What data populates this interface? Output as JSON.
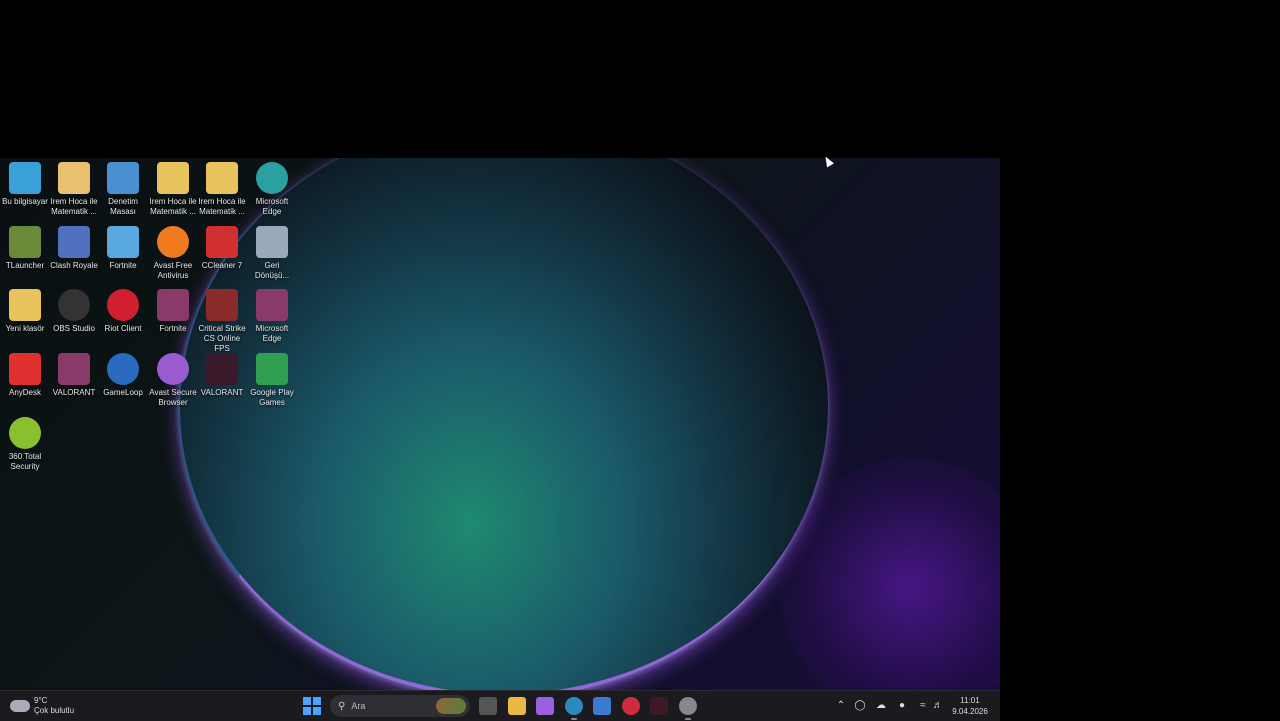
{
  "desktop": {
    "icons": [
      {
        "label": "Bu bilgisayar",
        "icon": "monitor-icon",
        "color": "#3aa0d8"
      },
      {
        "label": "Irem Hoca ile Matematik ...",
        "icon": "anime-avatar-icon",
        "color": "#e8c070"
      },
      {
        "label": "Denetim Masası",
        "icon": "control-panel-icon",
        "color": "#4a8fd0"
      },
      {
        "label": "Irem Hoca ile Matematik ...",
        "icon": "folder-icon",
        "color": "#e8c25a"
      },
      {
        "label": "Irem Hoca ile Matematik ...",
        "icon": "folder-icon",
        "color": "#e8c25a"
      },
      {
        "label": "Microsoft Edge",
        "icon": "edge-icon",
        "color": "#2aa0a0"
      },
      {
        "label": "TLauncher",
        "icon": "minecraft-block-icon",
        "color": "#6a8a3a"
      },
      {
        "label": "Clash Royale",
        "icon": "clash-royale-icon",
        "color": "#5070c0"
      },
      {
        "label": "Fortnite",
        "icon": "fortnite-icon",
        "color": "#5aa8e0"
      },
      {
        "label": "Avast Free Antivirus",
        "icon": "avast-icon",
        "color": "#f07a20"
      },
      {
        "label": "CCleaner 7",
        "icon": "ccleaner-icon",
        "color": "#d03030"
      },
      {
        "label": "Geri Dönüşü...",
        "icon": "recycle-bin-icon",
        "color": "#9ab"
      },
      {
        "label": "Yeni klasör",
        "icon": "folder-icon",
        "color": "#e8c25a"
      },
      {
        "label": "OBS Studio",
        "icon": "obs-icon",
        "color": "#333"
      },
      {
        "label": "Riot Client",
        "icon": "riot-icon",
        "color": "#d02030"
      },
      {
        "label": "Fortnite",
        "icon": "winrar-icon",
        "color": "#8a3a6a"
      },
      {
        "label": "Critical Strike CS Online FPS",
        "icon": "critical-strike-icon",
        "color": "#8a2a2a"
      },
      {
        "label": "Microsoft Edge",
        "icon": "winrar-icon",
        "color": "#8a3a6a"
      },
      {
        "label": "AnyDesk",
        "icon": "anydesk-icon",
        "color": "#e03030"
      },
      {
        "label": "VALORANT",
        "icon": "winrar-icon",
        "color": "#8a3a6a"
      },
      {
        "label": "GameLoop",
        "icon": "gameloop-icon",
        "color": "#2a6ac0"
      },
      {
        "label": "Avast Secure Browser",
        "icon": "avast-browser-icon",
        "color": "#9a5ad0"
      },
      {
        "label": "VALORANT",
        "icon": "valorant-icon",
        "color": "#3a1a2a"
      },
      {
        "label": "Google Play Games",
        "icon": "play-games-icon",
        "color": "#30a050"
      },
      {
        "label": "360 Total Security",
        "icon": "360-security-icon",
        "color": "#8ac030"
      }
    ]
  },
  "taskbar": {
    "weather": {
      "temp": "9°C",
      "condition": "Çok bulutlu"
    },
    "search": {
      "placeholder": "Ara"
    },
    "apps": [
      {
        "name": "task-view",
        "icon": "task-view-icon",
        "color": "#555"
      },
      {
        "name": "file-explorer",
        "icon": "folder-icon",
        "color": "#e8b840"
      },
      {
        "name": "copilot",
        "icon": "copilot-icon",
        "color": "#9a60e0"
      },
      {
        "name": "edge",
        "icon": "edge-icon",
        "color": "#2a8ac0"
      },
      {
        "name": "mail",
        "icon": "mail-icon",
        "color": "#3a7ad0"
      },
      {
        "name": "app-red",
        "icon": "red-app-icon",
        "color": "#d02a40"
      },
      {
        "name": "valorant",
        "icon": "valorant-icon",
        "color": "#3a1a24"
      },
      {
        "name": "chrome",
        "icon": "chrome-icon",
        "color": "#888"
      }
    ],
    "clock": {
      "time": "11:01",
      "date": "9.04.2026"
    }
  }
}
